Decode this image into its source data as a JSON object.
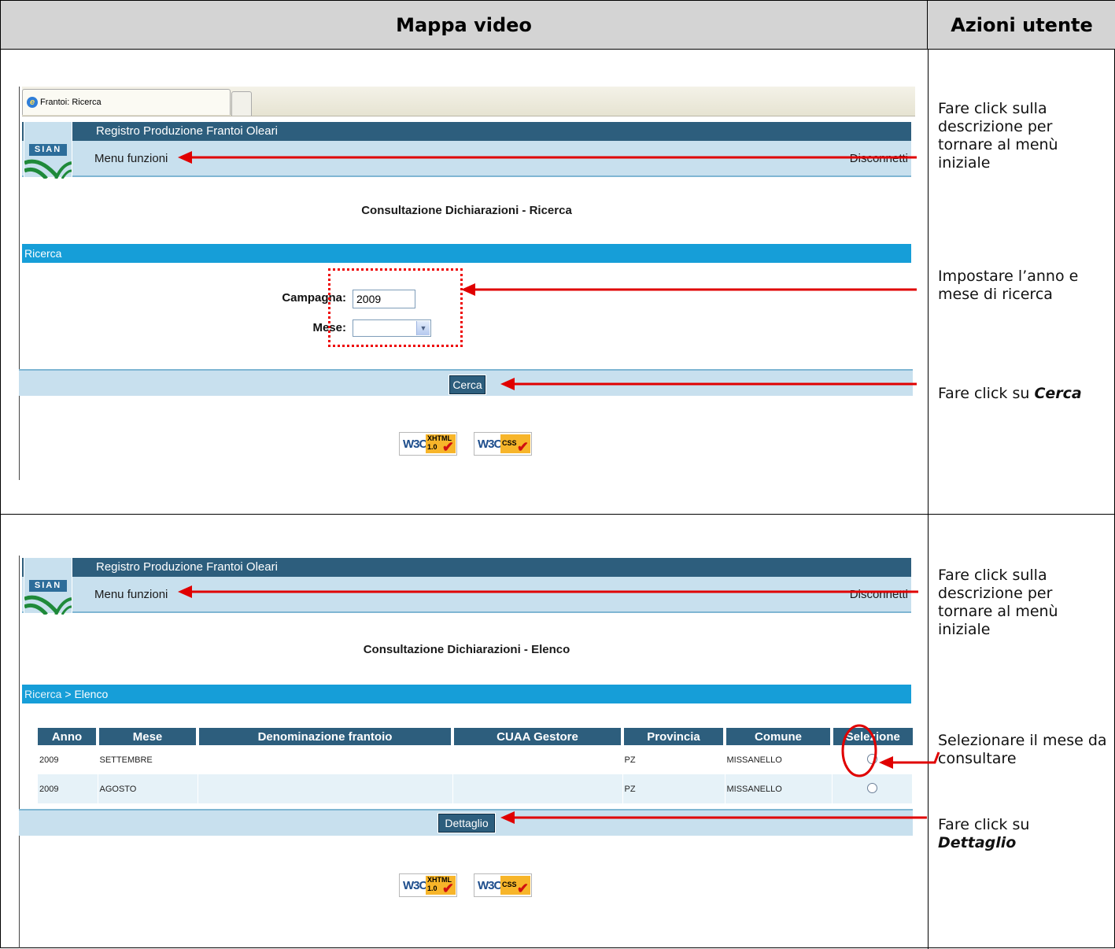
{
  "table": {
    "col_left_header": "Mappa video",
    "col_right_header": "Azioni utente"
  },
  "screen1": {
    "browser_tab": "Frantoi: Ricerca",
    "app_title": "Registro Produzione Frantoi Oleari",
    "logo_text": "SIAN",
    "menu_link": "Menu funzioni",
    "disconnect_link": "Disconnetti",
    "page_title": "Consultazione Dichiarazioni - Ricerca",
    "section_label": "Ricerca",
    "campagna_label": "Campagna:",
    "campagna_value": "2009",
    "mese_label": "Mese:",
    "mese_value": "",
    "search_button": "Cerca",
    "badge_xhtml_kind": "XHTML",
    "badge_xhtml_version": "1.0",
    "badge_css_kind": "CSS",
    "badge_w3c": "W3C"
  },
  "screen1_notes": {
    "note1": "Fare click sulla descrizione per tornare al menù iniziale",
    "note2": "Impostare l’anno e mese di ricerca",
    "note3_prefix": "Fare click su ",
    "note3_bold": "Cerca"
  },
  "screen2": {
    "app_title": "Registro Produzione Frantoi Oleari",
    "logo_text": "SIAN",
    "menu_link": "Menu funzioni",
    "disconnect_link": "Disconnetti",
    "page_title": "Consultazione Dichiarazioni - Elenco",
    "breadcrumb_link": "Ricerca",
    "breadcrumb_sep": " > ",
    "breadcrumb_current": "Elenco",
    "columns": [
      "Anno",
      "Mese",
      "Denominazione frantoio",
      "CUAA Gestore",
      "Provincia",
      "Comune",
      "Selezione"
    ],
    "rows": [
      {
        "anno": "2009",
        "mese": "SETTEMBRE",
        "denominazione": "",
        "cuaa": "",
        "provincia": "PZ",
        "comune": "MISSANELLO"
      },
      {
        "anno": "2009",
        "mese": "AGOSTO",
        "denominazione": "",
        "cuaa": "",
        "provincia": "PZ",
        "comune": "MISSANELLO"
      }
    ],
    "detail_button": "Dettaglio",
    "badge_xhtml_kind": "XHTML",
    "badge_xhtml_version": "1.0",
    "badge_css_kind": "CSS",
    "badge_w3c": "W3C"
  },
  "screen2_notes": {
    "note1": "Fare click sulla descrizione per tornare al menù iniziale",
    "note2": "Selezionare il mese da consultare",
    "note3_prefix": "Fare click su ",
    "note3_bold": "Dettaglio"
  },
  "colors": {
    "annotation_red": "#e00000",
    "sian_dark_blue": "#2d5e7d",
    "section_blue": "#169ed8",
    "light_blue": "#c8e0ee"
  }
}
